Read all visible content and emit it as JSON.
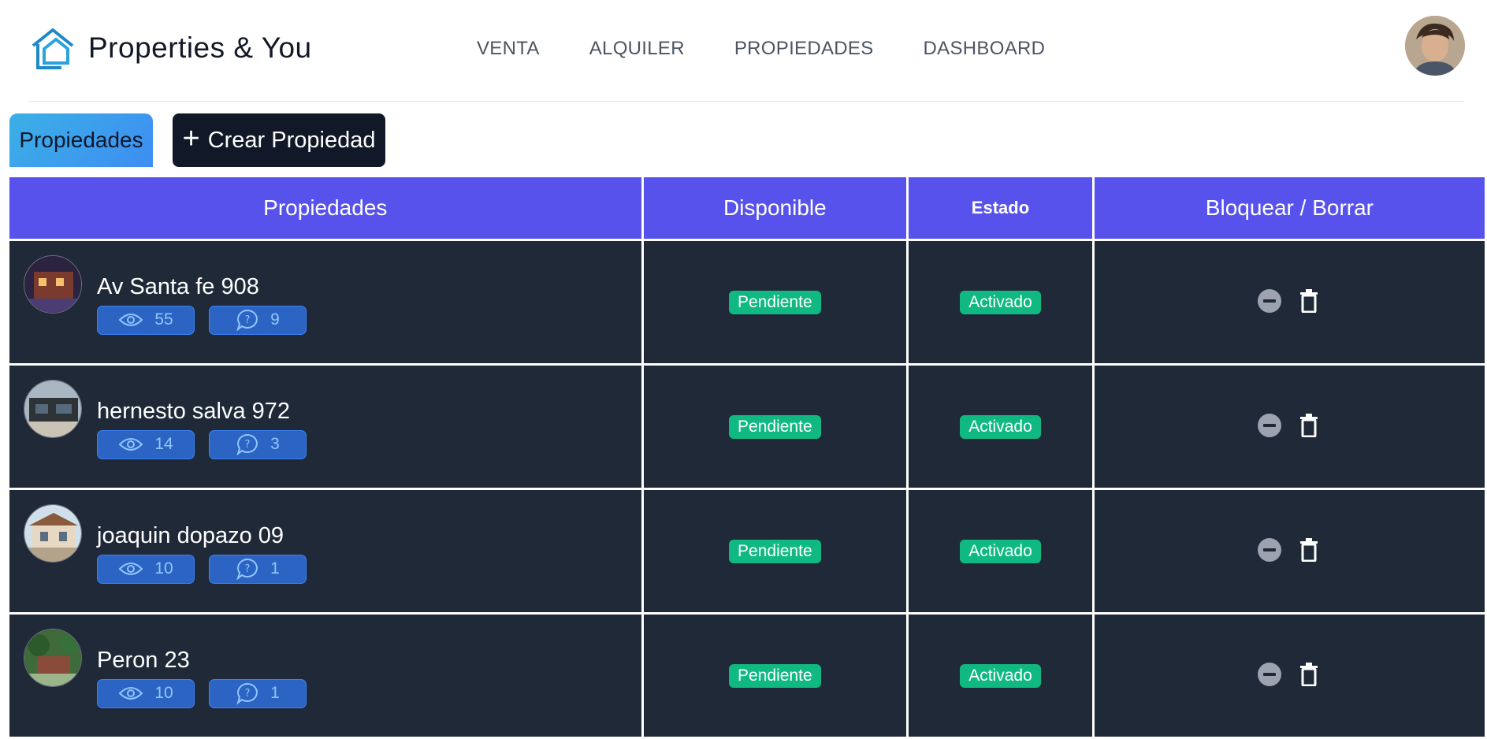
{
  "header": {
    "brand": "Properties & You",
    "nav": [
      "VENTA",
      "ALQUILER",
      "PROPIEDADES",
      "DASHBOARD"
    ]
  },
  "toolbar": {
    "tab_label": "Propiedades",
    "create_label": "Crear Propiedad"
  },
  "table": {
    "headers": [
      "Propiedades",
      "Disponible",
      "Estado",
      "Bloquear / Borrar"
    ],
    "rows": [
      {
        "name": "Av Santa fe 908",
        "views": "55",
        "questions": "9",
        "disponible": "Pendiente",
        "estado": "Activado"
      },
      {
        "name": "hernesto salva 972",
        "views": "14",
        "questions": "3",
        "disponible": "Pendiente",
        "estado": "Activado"
      },
      {
        "name": "joaquin dopazo 09",
        "views": "10",
        "questions": "1",
        "disponible": "Pendiente",
        "estado": "Activado"
      },
      {
        "name": "Peron 23",
        "views": "10",
        "questions": "1",
        "disponible": "Pendiente",
        "estado": "Activado"
      }
    ]
  },
  "colors": {
    "header_bg": "#5752eb",
    "row_bg": "#1f2937",
    "badge_green": "#10b981",
    "stat_bg": "#2b64c2"
  },
  "icons": {
    "logo": "house-logo-icon",
    "views": "eye-icon",
    "questions": "question-bubble-icon",
    "block": "minus-circle-icon",
    "delete": "trash-icon",
    "create": "plus-icon"
  }
}
